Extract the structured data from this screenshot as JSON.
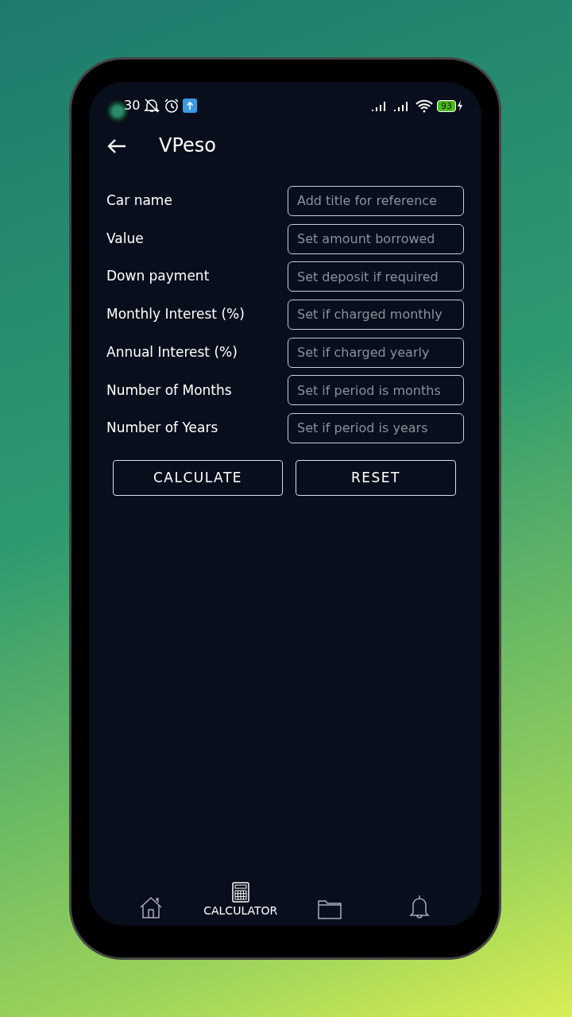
{
  "status_bar": {
    "time": "30",
    "battery": "93"
  },
  "app_bar": {
    "title": "VPeso"
  },
  "fields": [
    {
      "label": "Car name",
      "placeholder": "Add title for reference"
    },
    {
      "label": "Value",
      "placeholder": "Set amount borrowed"
    },
    {
      "label": "Down payment",
      "placeholder": "Set deposit if required"
    },
    {
      "label": "Monthly Interest (%)",
      "placeholder": "Set if charged monthly"
    },
    {
      "label": "Annual Interest (%)",
      "placeholder": "Set if charged yearly"
    },
    {
      "label": "Number of Months",
      "placeholder": "Set if period is months"
    },
    {
      "label": "Number of Years",
      "placeholder": "Set if period is years"
    }
  ],
  "buttons": [
    "CALCULATE",
    "RESET"
  ],
  "bottom_nav": [
    {
      "kind": "home",
      "selected": false
    },
    {
      "kind": "calculator",
      "label": "CALCULATOR",
      "selected": true
    },
    {
      "kind": "folder",
      "selected": false
    },
    {
      "kind": "bell",
      "selected": false
    }
  ]
}
